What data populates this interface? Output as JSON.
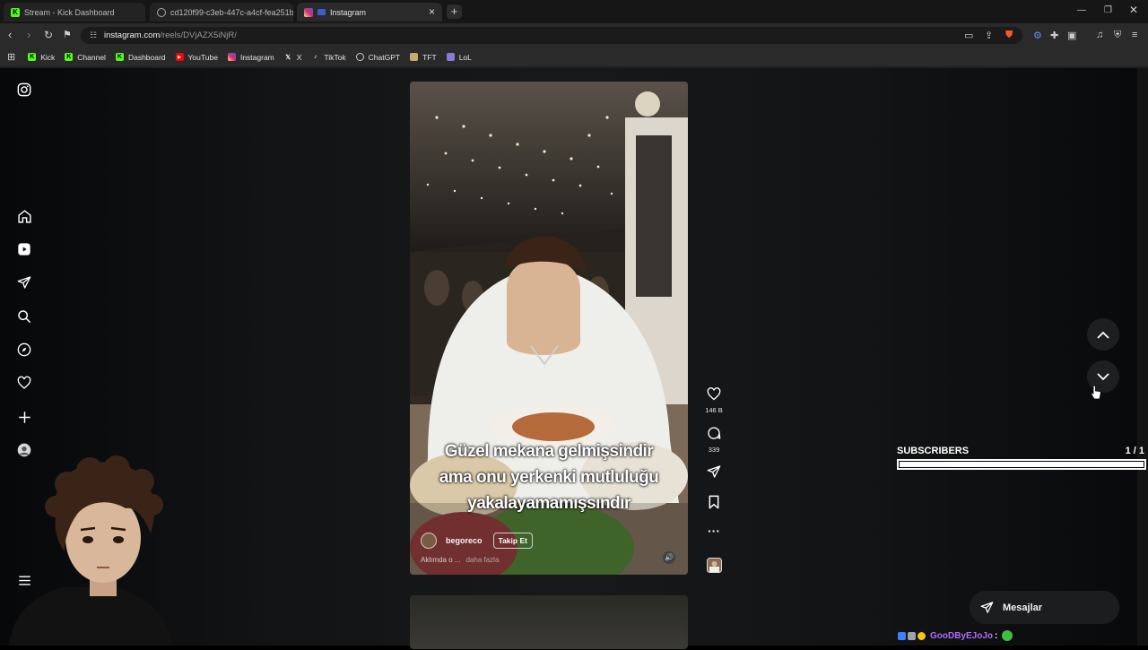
{
  "browser": {
    "tabs": [
      {
        "title": "Stream - Kick Dashboard",
        "icon": "kick-icon",
        "active": false
      },
      {
        "title": "cd120f99-c3eb-447c-a4cf-fea251b1",
        "icon": "globe-icon",
        "active": false
      },
      {
        "title": "Instagram",
        "icon": "instagram-icon",
        "active": true
      }
    ],
    "new_tab": "+",
    "url_host": "instagram.com",
    "url_path": "/reels/DVjAZX5iNjR/",
    "bookmarks": [
      {
        "label": "Kick",
        "icon": "kick-icon",
        "color": "#53fc18"
      },
      {
        "label": "Channel",
        "icon": "kick-icon",
        "color": "#53fc18"
      },
      {
        "label": "Dashboard",
        "icon": "kick-icon",
        "color": "#53fc18"
      },
      {
        "label": "YouTube",
        "icon": "youtube-icon",
        "color": "#ff0000"
      },
      {
        "label": "Instagram",
        "icon": "instagram-icon",
        "color": "#e1306c"
      },
      {
        "label": "X",
        "icon": "x-icon",
        "color": "#ffffff"
      },
      {
        "label": "TikTok",
        "icon": "tiktok-icon",
        "color": "#ffffff"
      },
      {
        "label": "ChatGPT",
        "icon": "chatgpt-icon",
        "color": "#ffffff"
      },
      {
        "label": "TFT",
        "icon": "tft-icon",
        "color": "#c8aa6e"
      },
      {
        "label": "LoL",
        "icon": "lol-icon",
        "color": "#8a7ad8"
      }
    ]
  },
  "reel": {
    "caption_lines": [
      "Güzel mekana gelmişsindir",
      "ama onu yerkenki mutluluğu",
      "yakalayamamışsındır"
    ],
    "author": "begoreco",
    "follow_label": "Takip Et",
    "description": "Aklımda o ...",
    "more_label": "daha fazla",
    "likes": "146 B",
    "comments": "339"
  },
  "overlay": {
    "subscribers_title": "SUBSCRIBERS",
    "subscribers_count": "1 / 1",
    "subscribers_progress": 1.0,
    "chat_user": "GooDByEJoJo",
    "chat_colon": ":"
  },
  "messages_label": "Mesajlar"
}
